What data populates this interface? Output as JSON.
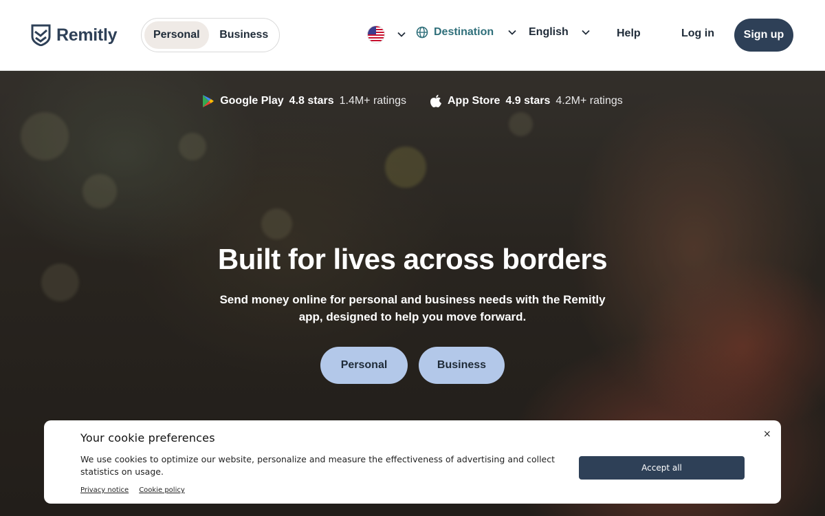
{
  "header": {
    "brand": "Remitly",
    "segment": {
      "personal": "Personal",
      "business": "Business",
      "active": "Personal"
    },
    "destination_label": "Destination",
    "language_label": "English",
    "help_label": "Help",
    "login_label": "Log in",
    "signup_label": "Sign up"
  },
  "hero": {
    "ratings": [
      {
        "store": "Google Play",
        "stars": "4.8 stars",
        "count": "1.4M+ ratings",
        "icon": "google-play-icon"
      },
      {
        "store": "App Store",
        "stars": "4.9 stars",
        "count": "4.2M+ ratings",
        "icon": "apple-icon"
      }
    ],
    "headline": "Built for lives across borders",
    "subline": "Send money online for personal and business needs with the Remitly app, designed to help you move forward.",
    "buttons": {
      "personal": "Personal",
      "business": "Business"
    }
  },
  "cookie": {
    "title": "Your cookie preferences",
    "text": "We use cookies to optimize our website, personalize and measure the effectiveness of advertising and collect statistics on usage.",
    "privacy_link": "Privacy notice",
    "cookie_link": "Cookie policy",
    "accept_label": "Accept all",
    "close_glyph": "×"
  },
  "colors": {
    "brand_navy": "#2e4057",
    "destination_teal": "#2f6f7a",
    "hero_button": "#b3c8e9"
  }
}
